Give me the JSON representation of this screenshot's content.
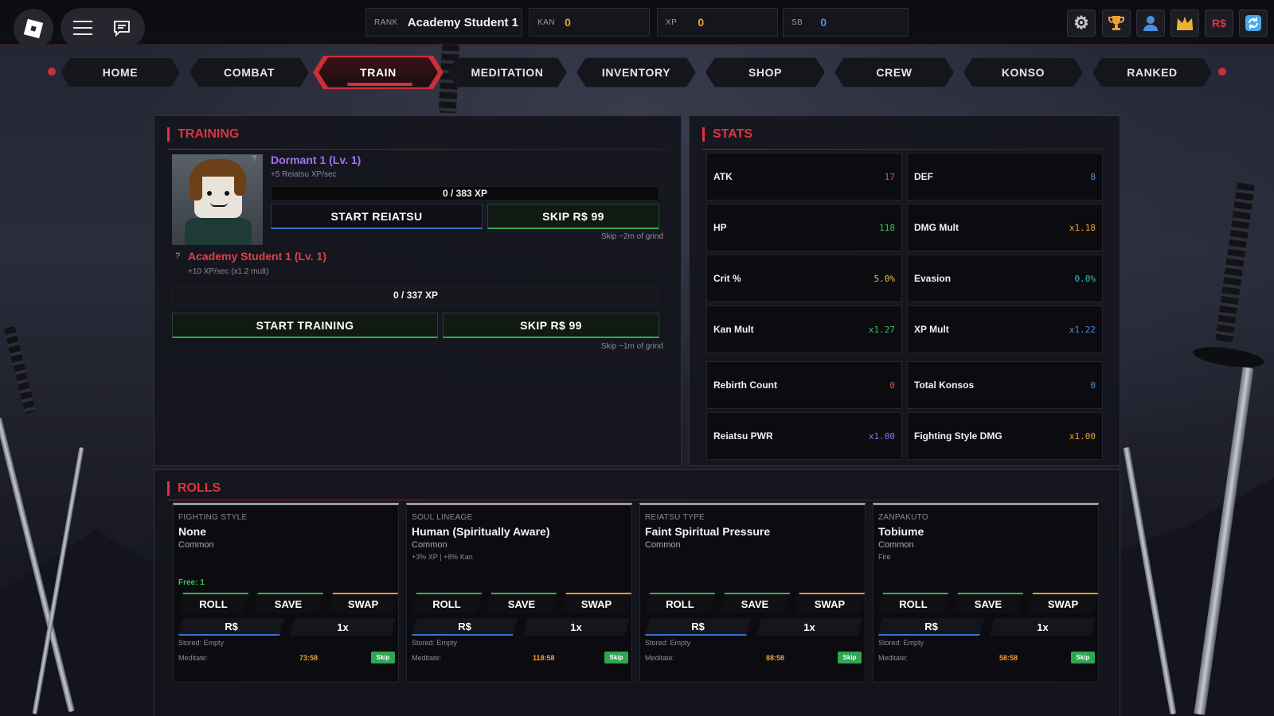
{
  "topbar": {
    "rank_label": "RANK",
    "rank_value": "Academy Student 1",
    "kan_label": "KAN",
    "kan_value": "0",
    "xp_label": "XP",
    "xp_value": "0",
    "sb_label": "SB",
    "sb_value": "0",
    "robux_label": "R$",
    "icons": [
      "roblox-logo-icon",
      "menu-icon",
      "chat-icon",
      "gear-icon",
      "trophy-icon",
      "profile-icon",
      "crown-icon",
      "robux-icon",
      "refresh-icon"
    ]
  },
  "tabs": [
    {
      "label": "HOME"
    },
    {
      "label": "COMBAT"
    },
    {
      "label": "TRAIN",
      "active": true
    },
    {
      "label": "MEDITATION"
    },
    {
      "label": "INVENTORY"
    },
    {
      "label": "SHOP"
    },
    {
      "label": "CREW"
    },
    {
      "label": "KONSO"
    },
    {
      "label": "RANKED"
    }
  ],
  "training": {
    "title": "TRAINING",
    "reiatsu": {
      "name": "Dormant 1 (Lv. 1)",
      "rate": "+5 Reiatsu XP/sec",
      "xp": "0 / 383 XP",
      "progress": 0,
      "start_label": "START REIATSU",
      "skip_label": "SKIP R$ 99",
      "skip_note": "Skip ~2m of grind"
    },
    "rank": {
      "name": "Academy Student 1 (Lv. 1)",
      "rate": "+10 XP/sec (x1.2 mult)",
      "xp": "0 / 337 XP",
      "progress": 0,
      "start_label": "START TRAINING",
      "skip_label": "SKIP R$ 99",
      "skip_note": "Skip ~1m of grind"
    },
    "help": "?"
  },
  "stats": {
    "title": "STATS",
    "items": [
      {
        "label": "ATK",
        "value": "17",
        "color": "#e0504a"
      },
      {
        "label": "DEF",
        "value": "8",
        "color": "#4a8ee0"
      },
      {
        "label": "HP",
        "value": "118",
        "color": "#3fbf5a"
      },
      {
        "label": "DMG Mult",
        "value": "x1.18",
        "color": "#f0a030"
      },
      {
        "label": "Crit %",
        "value": "5.0%",
        "color": "#f0c040"
      },
      {
        "label": "Evasion",
        "value": "0.0%",
        "color": "#3fc0c0"
      },
      {
        "label": "Kan Mult",
        "value": "x1.27",
        "color": "#3fbf5a"
      },
      {
        "label": "XP Mult",
        "value": "x1.22",
        "color": "#4a8ee0"
      },
      {
        "label": "Rebirth Count",
        "value": "0",
        "color": "#e0504a"
      },
      {
        "label": "Total Konsos",
        "value": "0",
        "color": "#4a8ee0"
      },
      {
        "label": "Reiatsu PWR",
        "value": "x1.00",
        "color": "#9a6ef0"
      },
      {
        "label": "Fighting Style DMG",
        "value": "x1.00",
        "color": "#f0a030"
      }
    ]
  },
  "rolls": {
    "title": "ROLLS",
    "cards": [
      {
        "category": "FIGHTING STYLE",
        "name": "None",
        "rarity": "Common",
        "bonus": "",
        "free": "Free: 1",
        "roll": "ROLL",
        "save": "SAVE",
        "swap": "SWAP",
        "rs": "R$",
        "mult": "1x",
        "stored": "Stored: Empty",
        "meditate": "Meditate:",
        "time": "73:58",
        "skip": "Skip"
      },
      {
        "category": "SOUL LINEAGE",
        "name": "Human (Spiritually Aware)",
        "rarity": "Common",
        "bonus": "+3% XP | +8% Kan",
        "free": "",
        "roll": "ROLL",
        "save": "SAVE",
        "swap": "SWAP",
        "rs": "R$",
        "mult": "1x",
        "stored": "Stored: Empty",
        "meditate": "Meditate:",
        "time": "118:58",
        "skip": "Skip"
      },
      {
        "category": "REIATSU TYPE",
        "name": "Faint Spiritual Pressure",
        "rarity": "Common",
        "bonus": "",
        "free": "",
        "roll": "ROLL",
        "save": "SAVE",
        "swap": "SWAP",
        "rs": "R$",
        "mult": "1x",
        "stored": "Stored: Empty",
        "meditate": "Meditate:",
        "time": "88:58",
        "skip": "Skip"
      },
      {
        "category": "ZANPAKUTO",
        "name": "Tobiume",
        "rarity": "Common",
        "bonus": "Fire",
        "free": "",
        "roll": "ROLL",
        "save": "SAVE",
        "swap": "SWAP",
        "rs": "R$",
        "mult": "1x",
        "stored": "Stored: Empty",
        "meditate": "Meditate:",
        "time": "58:58",
        "skip": "Skip"
      }
    ]
  }
}
